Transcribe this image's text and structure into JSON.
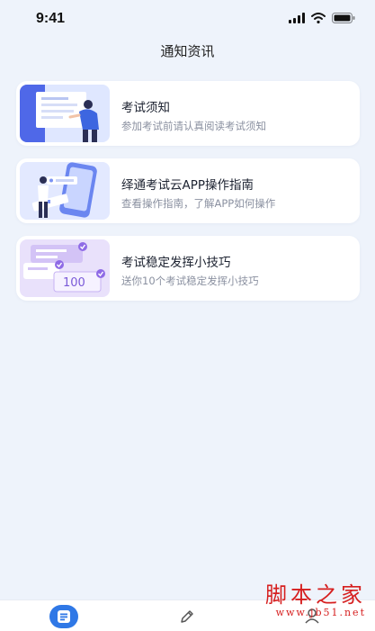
{
  "status_bar": {
    "time": "9:41"
  },
  "header": {
    "title": "通知资讯"
  },
  "cards": [
    {
      "title": "考试须知",
      "subtitle": "参加考试前请认真阅读考试须知"
    },
    {
      "title": "绎通考试云APP操作指南",
      "subtitle": "查看操作指南，了解APP如何操作"
    },
    {
      "title": "考试稳定发挥小技巧",
      "subtitle": "送你10个考试稳定发挥小技巧"
    }
  ],
  "card_illustrations": {
    "score_label": "100"
  },
  "watermark": {
    "main": "脚本之家",
    "url": "www.jb51.net"
  },
  "colors": {
    "accent": "#2f78e6",
    "background": "#eef3fb",
    "watermark": "#d61f1f"
  },
  "tab_bar": {
    "icons": [
      "document-icon",
      "pencil-icon",
      "user-icon"
    ]
  }
}
